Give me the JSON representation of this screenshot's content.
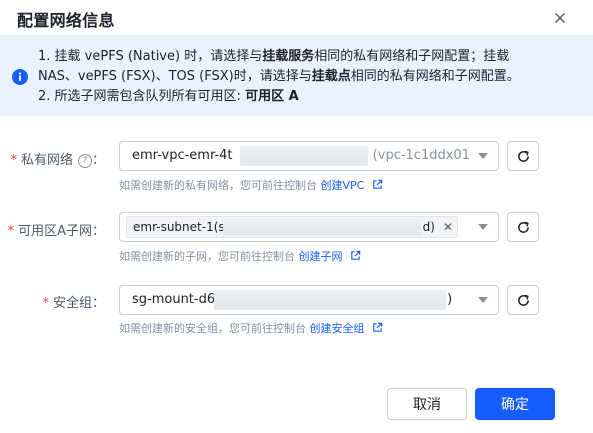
{
  "dialog": {
    "title": "配置网络信息",
    "close_icon": "close-icon"
  },
  "alert": {
    "line1_pre": "1. 挂载 vePFS (Native) 时，请选择与",
    "line1_bold": "挂载服务",
    "line1_post": "相同的私有网络和子网配置；挂载",
    "line2_pre": "NAS、vePFS (FSX)、TOS (FSX)时，请选择与",
    "line2_bold": "挂载点",
    "line2_post": "相同的私有网络和子网配置。",
    "line3_pre": "2. 所选子网需包含队列所有可用区: ",
    "line3_bold": "可用区 A"
  },
  "vpc": {
    "label": "私有网络",
    "value_prefix": "emr-vpc-emr-4t",
    "value_suffix": "e  (vpc-1c1ddx01",
    "hint_text": "如需创建新的私有网络，您可前往控制台 ",
    "hint_link": "创建VPC"
  },
  "subnet": {
    "label": "可用区A子网",
    "tag_prefix": "emr-subnet-1(s",
    "tag_suffix": "d)",
    "hint_text": "如需创建新的子网，您可前往控制台 ",
    "hint_link": "创建子网"
  },
  "security_group": {
    "label": "安全组",
    "value_prefix": "sg-mount-d6",
    "value_suffix": ")",
    "hint_text": "如需创建新的安全组，您可前往控制台 ",
    "hint_link": "创建安全组"
  },
  "footer": {
    "cancel_label": "取消",
    "confirm_label": "确定"
  },
  "colors": {
    "primary": "#165dff",
    "alert_bg": "#e8f3ff",
    "required": "#f53f3f"
  }
}
